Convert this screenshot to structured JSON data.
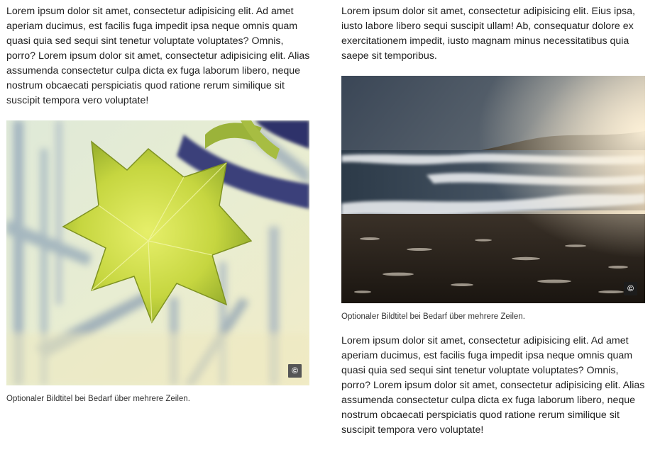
{
  "left_column": {
    "paragraph": "Lorem ipsum dolor sit amet, consectetur adipisicing elit. Ad amet aperiam ducimus, est facilis fuga impedit ipsa neque omnis quam quasi quia sed sequi sint tenetur voluptate voluptates? Omnis, porro? Lorem ipsum dolor sit amet, consectetur adipisicing elit. Alias assumenda consectetur culpa dicta ex fuga laborum libero, neque nostrum obcaecati perspiciatis quod ratione rerum similique sit suscipit tempora vero voluptate!",
    "figure": {
      "copyright_symbol": "©",
      "caption": "Optionaler Bildtitel bei Bedarf über mehrere Zeilen."
    }
  },
  "right_column": {
    "paragraph_top": "Lorem ipsum dolor sit amet, consectetur adipisicing elit. Eius ipsa, iusto labore libero sequi suscipit ullam! Ab, consequatur dolore ex exercitationem impedit, iusto magnam minus necessitatibus quia saepe sit temporibus.",
    "figure": {
      "copyright_symbol": "©",
      "caption": "Optionaler Bildtitel bei Bedarf über mehrere Zeilen."
    },
    "paragraph_bottom": "Lorem ipsum dolor sit amet, consectetur adipisicing elit. Ad amet aperiam ducimus, est facilis fuga impedit ipsa neque omnis quam quasi quia sed sequi sint tenetur voluptate voluptates? Omnis, porro? Lorem ipsum dolor sit amet, consectetur adipisicing elit. Alias assumenda consectetur culpa dicta ex fuga laborum libero, neque nostrum obcaecati perspiciatis quod ratione rerum similique sit suscipit tempora vero voluptate!"
  }
}
